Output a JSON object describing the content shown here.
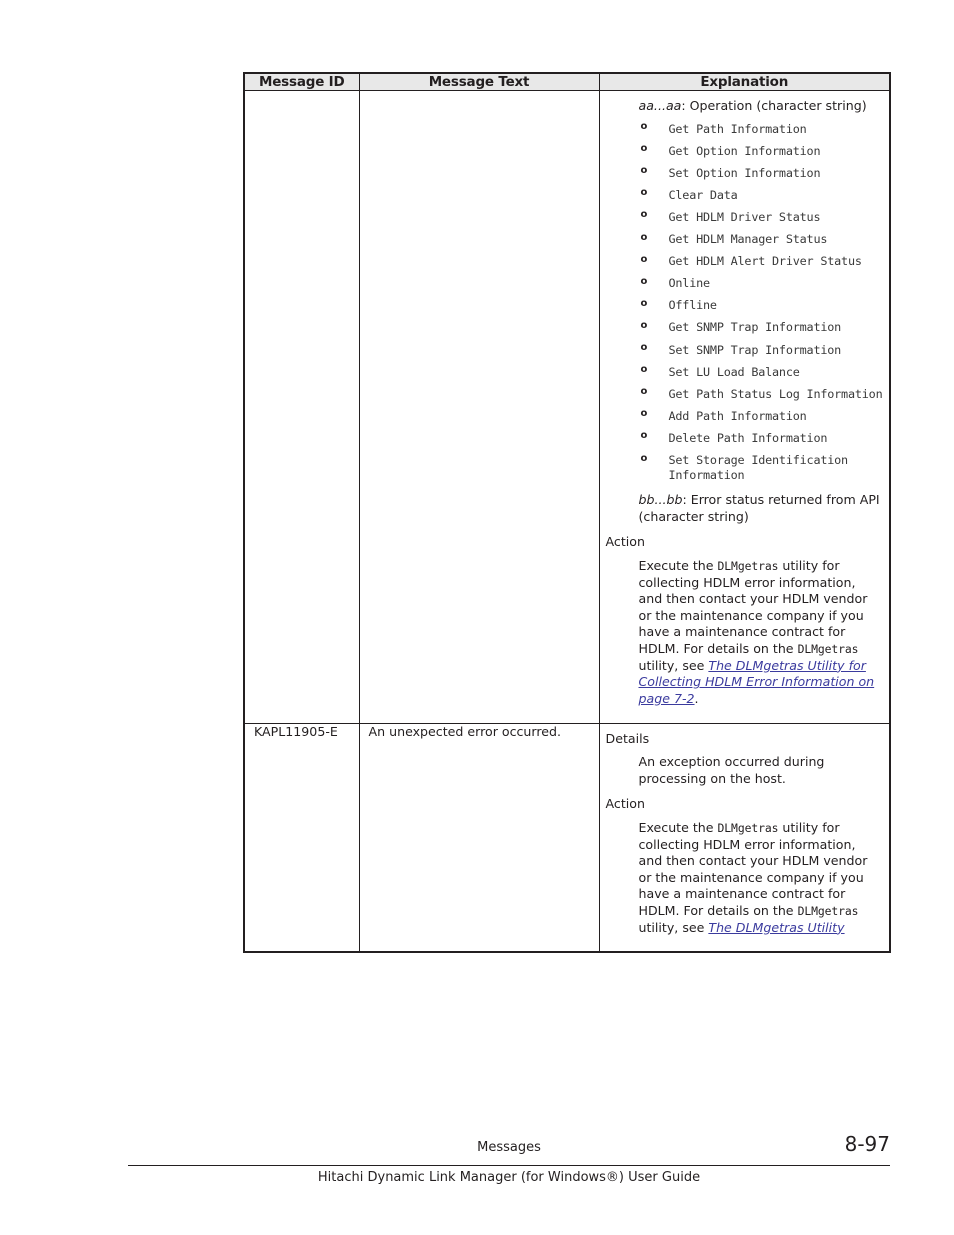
{
  "document": {
    "table": {
      "headers": [
        "Message ID",
        "Message Text",
        "Explanation"
      ],
      "rows": [
        {
          "message_id": "",
          "message_text": "",
          "explanation": {
            "variable_aa_label": "aa...aa",
            "variable_aa_desc": ": Operation (character string)",
            "operations": [
              "Get Path Information",
              "Get Option Information",
              "Set Option Information",
              "Clear Data",
              "Get HDLM Driver Status",
              "Get HDLM Manager Status",
              "Get HDLM Alert Driver Status",
              "Online",
              "Offline",
              "Get SNMP Trap Information",
              "Set SNMP Trap Information",
              "Set LU Load Balance",
              "Get Path Status Log Information",
              "Add Path Information",
              "Delete Path Information",
              "Set Storage Identification Information"
            ],
            "variable_bb_label": "bb...bb",
            "variable_bb_desc": ": Error status returned from API (character string)",
            "action_label": "Action",
            "action_text_1": "Execute the ",
            "action_mono_1": "DLMgetras",
            "action_text_2": " utility for collecting HDLM error information, and then contact your HDLM vendor or the maintenance company if you have a maintenance contract for HDLM. For details on the ",
            "action_mono_2": "DLMgetras",
            "action_text_3": " utility, see ",
            "action_link": "The DLMgetras Utility for Collecting HDLM Error Information on page 7-2",
            "action_text_4": "."
          }
        },
        {
          "message_id": "KAPL11905-E",
          "message_text": "An unexpected error occurred.",
          "explanation": {
            "details_label": "Details",
            "details_text": "An exception occurred during processing on the host.",
            "action_label": "Action",
            "action_text_1": "Execute the ",
            "action_mono_1": "DLMgetras",
            "action_text_2": " utility for collecting HDLM error information, and then contact your HDLM vendor or the maintenance company if you have a maintenance contract for HDLM. For details on the ",
            "action_mono_2": "DLMgetras",
            "action_text_3": " utility, see ",
            "action_link": "The DLMgetras Utility",
            "action_text_4": ""
          }
        }
      ]
    },
    "footer": {
      "section": "Messages",
      "page_number": "8-97",
      "guide_title": "Hitachi Dynamic Link Manager (for Windows®) User Guide"
    }
  }
}
